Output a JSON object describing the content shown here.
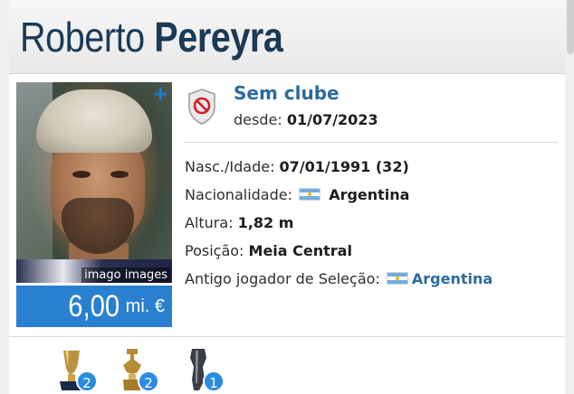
{
  "player": {
    "first_name": "Roberto",
    "last_name": "Pereyra"
  },
  "photo": {
    "credit": "imago images"
  },
  "market_value": {
    "amount": "6,00",
    "unit": "mi. €"
  },
  "club": {
    "name": "Sem clube",
    "since_label": "desde:",
    "since_date": "01/07/2023"
  },
  "info": {
    "birth_label": "Nasc./Idade:",
    "birth_value": "07/01/1991 (32)",
    "nationality_label": "Nacionalidade:",
    "nationality_value": "Argentina",
    "height_label": "Altura:",
    "height_value": "1,82 m",
    "position_label": "Posição:",
    "position_value": "Meia Central",
    "national_label": "Antigo jogador de Seleção:",
    "national_value": "Argentina"
  },
  "trophies": [
    {
      "name": "cup-trophy-icon",
      "count": "2"
    },
    {
      "name": "supercup-trophy-icon",
      "count": "2"
    },
    {
      "name": "league-trophy-icon",
      "count": "1"
    }
  ],
  "colors": {
    "value_box": "#2a7fcf",
    "link": "#2b6aa0",
    "badge": "#2a8be0"
  }
}
